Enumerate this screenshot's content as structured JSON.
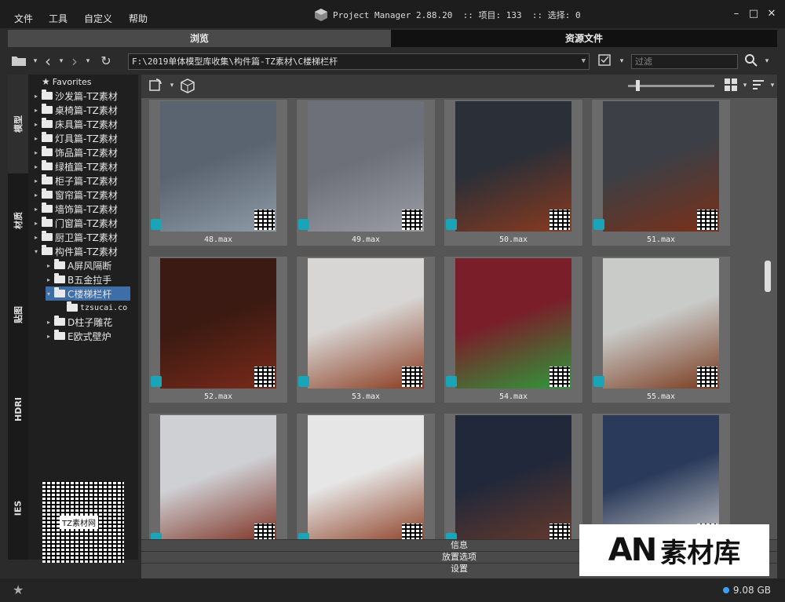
{
  "menu": [
    "文件",
    "工具",
    "自定义",
    "帮助"
  ],
  "window": {
    "app_name": "Project Manager",
    "version": "2.88.20",
    "sep": "::",
    "items_label": "项目:",
    "items_count": "133",
    "selection_label": "选择:",
    "selection_count": "0"
  },
  "tabs": {
    "browse": "浏览",
    "assets": "资源文件"
  },
  "toolbar": {
    "path": "F:\\2019单体模型库收集\\构件篇-TZ素材\\C楼梯栏杆",
    "filter_placeholder": "过滤"
  },
  "vertical_tabs": [
    "模型",
    "材质",
    "贴图",
    "HDRI",
    "IES"
  ],
  "tree": [
    {
      "label": "Favorites",
      "arrow": "",
      "icon": "star"
    },
    {
      "label": "沙发篇-TZ素材",
      "arrow": "▸"
    },
    {
      "label": "桌椅篇-TZ素材",
      "arrow": "▸"
    },
    {
      "label": "床具篇-TZ素材",
      "arrow": "▸"
    },
    {
      "label": "灯具篇-TZ素材",
      "arrow": "▸"
    },
    {
      "label": "饰品篇-TZ素材",
      "arrow": "▸"
    },
    {
      "label": "绿植篇-TZ素材",
      "arrow": "▸"
    },
    {
      "label": "柜子篇-TZ素材",
      "arrow": "▸"
    },
    {
      "label": "窗帘篇-TZ素材",
      "arrow": "▸"
    },
    {
      "label": "墙饰篇-TZ素材",
      "arrow": "▸"
    },
    {
      "label": "门窗篇-TZ素材",
      "arrow": "▸"
    },
    {
      "label": "厨卫篇-TZ素材",
      "arrow": "▸"
    },
    {
      "label": "构件篇-TZ素材",
      "arrow": "▾"
    },
    {
      "label": "A屏风隔断",
      "arrow": "▸"
    },
    {
      "label": "B五金拉手",
      "arrow": "▸"
    },
    {
      "label": "C楼梯栏杆",
      "arrow": "▾",
      "selected": true
    },
    {
      "label": "tzsucai.co",
      "arrow": ""
    },
    {
      "label": "D柱子雕花",
      "arrow": "▸"
    },
    {
      "label": "E欧式壁炉",
      "arrow": "▸"
    }
  ],
  "tree_qr_caption": "TZ素材网",
  "grid": [
    {
      "label": "48.max"
    },
    {
      "label": "49.max"
    },
    {
      "label": "50.max"
    },
    {
      "label": "51.max"
    },
    {
      "label": "52.max"
    },
    {
      "label": "53.max"
    },
    {
      "label": "54.max"
    },
    {
      "label": "55.max"
    },
    {
      "label": ""
    },
    {
      "label": ""
    },
    {
      "label": ""
    },
    {
      "label": ""
    }
  ],
  "panels": {
    "info": "信息",
    "placement": "放置选项",
    "settings": "设置"
  },
  "status": {
    "disk": "9.08 GB"
  },
  "watermark": {
    "mark": "AN",
    "text": "素材库"
  },
  "colors": {
    "selected": "#3d6ea8",
    "accent": "#1aa4b8"
  }
}
